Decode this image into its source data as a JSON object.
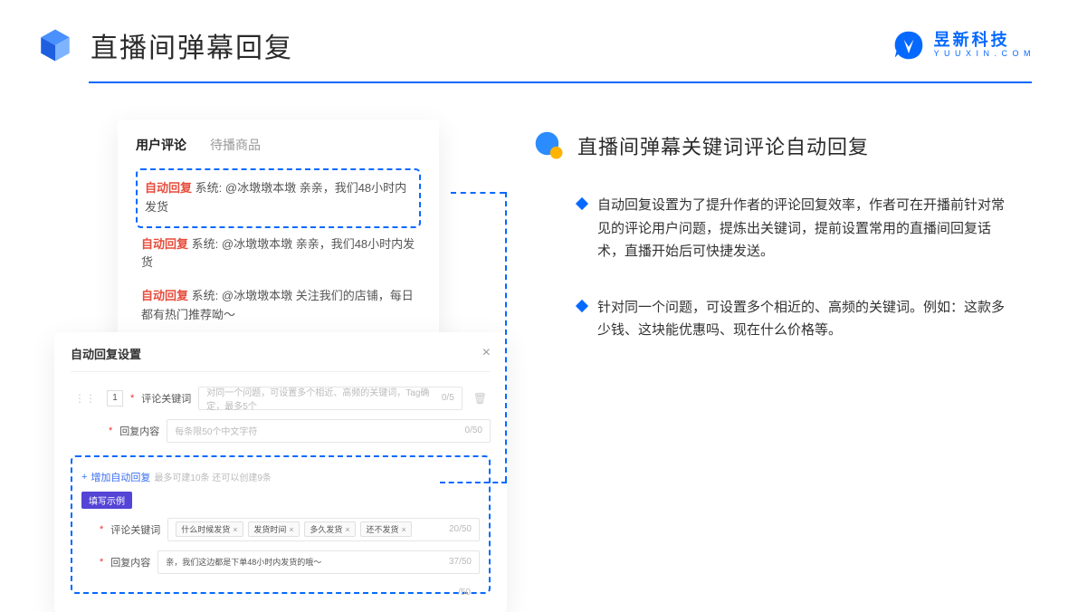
{
  "header": {
    "title": "直播间弹幕回复",
    "brand": {
      "name": "昱新科技",
      "url": "Y U U X I N . C O M"
    }
  },
  "comments": {
    "tab_active": "用户评论",
    "tab_inactive": "待播商品",
    "auto_label": "自动回复",
    "sys_label": "系统:",
    "rows": [
      {
        "text": "@冰墩墩本墩 亲亲，我们48小时内发货"
      },
      {
        "text": "@冰墩墩本墩 亲亲，我们48小时内发货"
      },
      {
        "text": "@冰墩墩本墩 关注我们的店铺，每日都有热门推荐呦～"
      }
    ]
  },
  "settings": {
    "title": "自动回复设置",
    "num": "1",
    "kw_label": "评论关键词",
    "kw_placeholder": "对同一个问题，可设置多个相近、高频的关键词，Tag确定，最多5个",
    "kw_counter": "0/5",
    "content_label": "回复内容",
    "content_placeholder": "每条限50个中文字符",
    "content_counter": "0/50",
    "add_text": "增加自动回复",
    "add_hint": "最多可建10条 还可以创建9条",
    "badge": "填写示例",
    "sample": {
      "kw_label": "评论关键词",
      "tags": [
        "什么时候发货",
        "发货时间",
        "多久发货",
        "还不发货"
      ],
      "kw_counter": "20/50",
      "content_label": "回复内容",
      "content_text": "亲，我们这边都是下单48小时内发货的哦～",
      "content_counter": "37/50",
      "outer_counter": "/50"
    }
  },
  "right": {
    "section_title": "直播间弹幕关键词评论自动回复",
    "bullets": [
      "自动回复设置为了提升作者的评论回复效率，作者可在开播前针对常见的评论用户问题，提炼出关键词，提前设置常用的直播间回复话术，直播开始后可快捷发送。",
      "针对同一个问题，可设置多个相近的、高频的关键词。例如：这款多少钱、这块能优惠吗、现在什么价格等。"
    ]
  }
}
